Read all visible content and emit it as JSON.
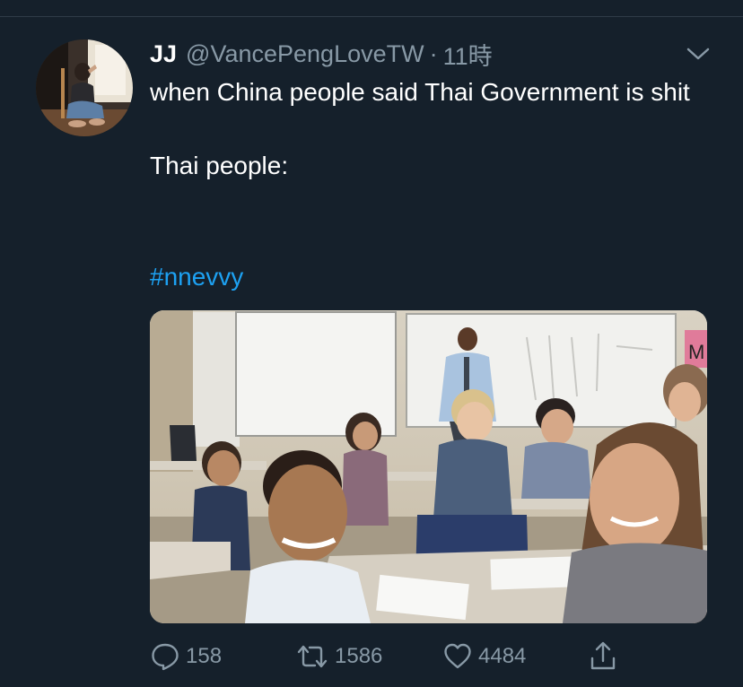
{
  "tweet": {
    "display_name": "JJ",
    "handle": "@VancePengLoveTW",
    "separator": "·",
    "time": "11時",
    "text_line1": "when China people said Thai Government is shit",
    "text_line2": "Thai people:",
    "hashtag": "#nnevvy"
  },
  "media": {
    "board_sign": "M"
  },
  "actions": {
    "reply_count": "158",
    "retweet_count": "1586",
    "like_count": "4484"
  },
  "icons": {
    "reply": "speech-bubble-icon",
    "retweet": "retweet-icon",
    "like": "heart-icon",
    "share": "share-icon",
    "menu": "chevron-down-icon"
  },
  "colors": {
    "background": "#15202b",
    "secondary_text": "#8899a6",
    "link": "#1da1f2"
  }
}
